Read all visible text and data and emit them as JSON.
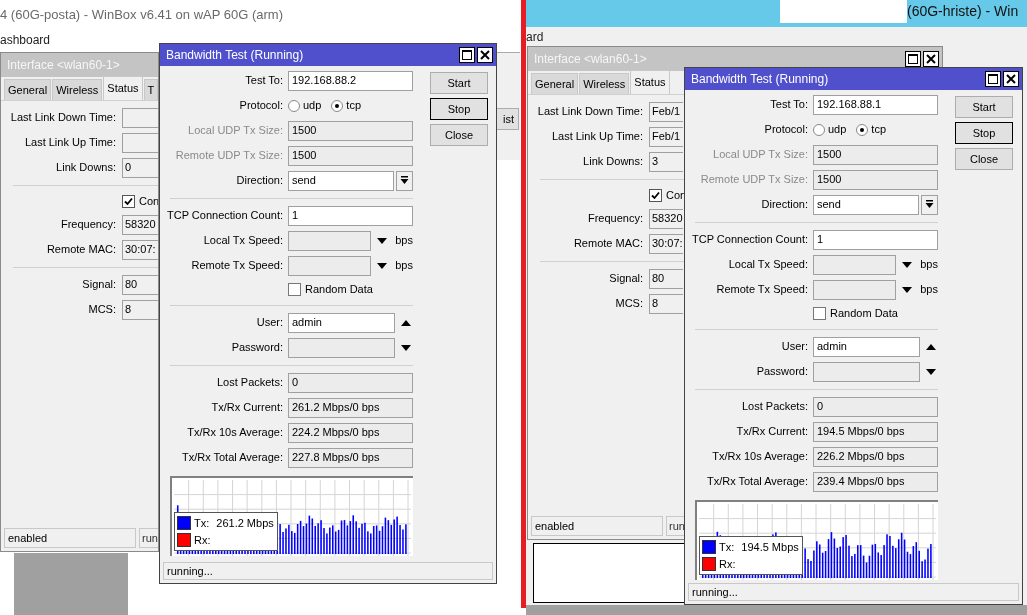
{
  "panels": [
    {
      "app_title": "4 (60G-posta) - WinBox v6.41 on wAP 60G (arm)",
      "menu_item": "ashboard",
      "back_button": "ist",
      "interface_window": {
        "title": "Interface <wlan60-1>",
        "tabs": [
          {
            "label": "General",
            "selected": false
          },
          {
            "label": "Wireless",
            "selected": false
          },
          {
            "label": "Status",
            "selected": true
          },
          {
            "label": "T",
            "selected": false
          }
        ],
        "rows": [
          {
            "kind": "field",
            "label": "Last Link Down Time:"
          },
          {
            "kind": "field",
            "label": "Last Link Up Time:"
          },
          {
            "kind": "field",
            "label": "Link Downs:",
            "value": "0"
          },
          {
            "kind": "separator"
          },
          {
            "kind": "checkbox",
            "label": "Con",
            "checked": true
          },
          {
            "kind": "field",
            "label": "Frequency:",
            "value": "58320"
          },
          {
            "kind": "field",
            "label": "Remote MAC:",
            "value": "30:07:"
          },
          {
            "kind": "separator"
          },
          {
            "kind": "field",
            "label": "Signal:",
            "value": "80"
          },
          {
            "kind": "field",
            "label": "MCS:",
            "value": "8"
          }
        ],
        "status": [
          "enabled",
          "run"
        ]
      },
      "bandwidth_test": {
        "title": "Bandwidth Test (Running)",
        "rows": [
          {
            "kind": "text",
            "label": "Test To:",
            "value": "192.168.88.2",
            "disabled": false
          },
          {
            "kind": "radio",
            "label": "Protocol:",
            "options": [
              {
                "label": "udp",
                "selected": false
              },
              {
                "label": "tcp",
                "selected": true
              }
            ]
          },
          {
            "kind": "text",
            "label": "Local UDP Tx Size:",
            "value": "1500",
            "disabled": true
          },
          {
            "kind": "text",
            "label": "Remote UDP Tx Size:",
            "value": "1500",
            "disabled": true
          },
          {
            "kind": "select",
            "label": "Direction:",
            "value": "send"
          },
          {
            "kind": "separator"
          },
          {
            "kind": "text",
            "label": "TCP Connection Count:",
            "value": "1",
            "disabled": false
          },
          {
            "kind": "speed",
            "label": "Local Tx Speed:",
            "unit": "bps"
          },
          {
            "kind": "speed",
            "label": "Remote Tx Speed:",
            "unit": "bps"
          },
          {
            "kind": "checkbox",
            "label": "Random Data",
            "checked": false
          },
          {
            "kind": "separator"
          },
          {
            "kind": "removable",
            "label": "User:",
            "value": "admin"
          },
          {
            "kind": "expandable",
            "label": "Password:"
          },
          {
            "kind": "separator"
          },
          {
            "kind": "readout",
            "label": "Lost Packets:",
            "value": "0"
          },
          {
            "kind": "readout",
            "label": "Tx/Rx Current:",
            "value": "261.2 Mbps/0 bps"
          },
          {
            "kind": "readout",
            "label": "Tx/Rx 10s Average:",
            "value": "224.2 Mbps/0 bps"
          },
          {
            "kind": "readout",
            "label": "Tx/Rx Total Average:",
            "value": "227.8 Mbps/0 bps"
          }
        ],
        "buttons": [
          {
            "label": "Start",
            "default": false
          },
          {
            "label": "Stop",
            "default": true
          },
          {
            "label": "Close",
            "default": false
          }
        ],
        "legend": [
          {
            "label": "Tx:",
            "value": "261.2 Mbps",
            "color": "#0000ff"
          },
          {
            "label": "Rx:",
            "color": "#ff0000"
          }
        ],
        "status": "running..."
      }
    },
    {
      "app_title": "(60G-hriste) - Win",
      "menu_item": "ard",
      "interface_window": {
        "title": "Interface <wlan60-1>",
        "tabs": [
          {
            "label": "General",
            "selected": false
          },
          {
            "label": "Wireless",
            "selected": false
          },
          {
            "label": "Status",
            "selected": true
          }
        ],
        "rows": [
          {
            "kind": "field",
            "label": "Last Link Down Time:",
            "value": "Feb/1"
          },
          {
            "kind": "field",
            "label": "Last Link Up Time:",
            "value": "Feb/1"
          },
          {
            "kind": "field",
            "label": "Link Downs:",
            "value": "3"
          },
          {
            "kind": "separator"
          },
          {
            "kind": "checkbox",
            "label": "Con",
            "checked": true
          },
          {
            "kind": "field",
            "label": "Frequency:",
            "value": "58320"
          },
          {
            "kind": "field",
            "label": "Remote MAC:",
            "value": "30:07:"
          },
          {
            "kind": "separator"
          },
          {
            "kind": "field",
            "label": "Signal:",
            "value": "80"
          },
          {
            "kind": "field",
            "label": "MCS:",
            "value": "8"
          }
        ],
        "status": [
          "enabled",
          "run"
        ]
      },
      "bandwidth_test": {
        "title": "Bandwidth Test (Running)",
        "rows": [
          {
            "kind": "text",
            "label": "Test To:",
            "value": "192.168.88.1",
            "disabled": false
          },
          {
            "kind": "radio",
            "label": "Protocol:",
            "options": [
              {
                "label": "udp",
                "selected": false
              },
              {
                "label": "tcp",
                "selected": true
              }
            ]
          },
          {
            "kind": "text",
            "label": "Local UDP Tx Size:",
            "value": "1500",
            "disabled": true
          },
          {
            "kind": "text",
            "label": "Remote UDP Tx Size:",
            "value": "1500",
            "disabled": true
          },
          {
            "kind": "select",
            "label": "Direction:",
            "value": "send"
          },
          {
            "kind": "separator"
          },
          {
            "kind": "text",
            "label": "TCP Connection Count:",
            "value": "1",
            "disabled": false
          },
          {
            "kind": "speed",
            "label": "Local Tx Speed:",
            "unit": "bps"
          },
          {
            "kind": "speed",
            "label": "Remote Tx Speed:",
            "unit": "bps"
          },
          {
            "kind": "checkbox",
            "label": "Random Data",
            "checked": false
          },
          {
            "kind": "separator"
          },
          {
            "kind": "removable",
            "label": "User:",
            "value": "admin"
          },
          {
            "kind": "expandable",
            "label": "Password:"
          },
          {
            "kind": "separator"
          },
          {
            "kind": "readout",
            "label": "Lost Packets:",
            "value": "0"
          },
          {
            "kind": "readout",
            "label": "Tx/Rx Current:",
            "value": "194.5 Mbps/0 bps"
          },
          {
            "kind": "readout",
            "label": "Tx/Rx 10s Average:",
            "value": "226.2 Mbps/0 bps"
          },
          {
            "kind": "readout",
            "label": "Tx/Rx Total Average:",
            "value": "239.4 Mbps/0 bps"
          }
        ],
        "buttons": [
          {
            "label": "Start",
            "default": false
          },
          {
            "label": "Stop",
            "default": true
          },
          {
            "label": "Close",
            "default": false
          }
        ],
        "legend": [
          {
            "label": "Tx:",
            "value": "194.5 Mbps",
            "color": "#0000ff"
          },
          {
            "label": "Rx:",
            "color": "#ff0000"
          }
        ],
        "status": "running..."
      }
    }
  ]
}
